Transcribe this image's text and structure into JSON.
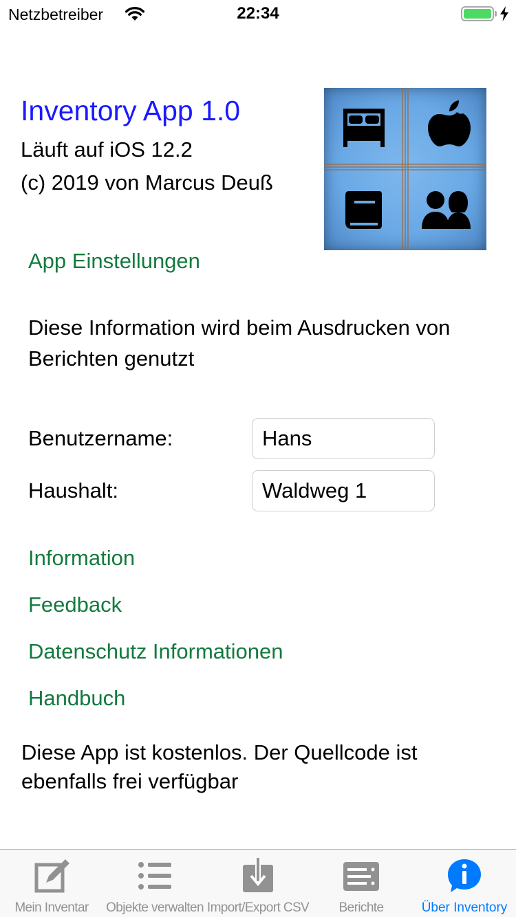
{
  "status_bar": {
    "carrier": "Netzbetreiber",
    "time": "22:34",
    "battery_level": 1.0
  },
  "header": {
    "title": "Inventory App 1.0",
    "ios_version": "Läuft auf iOS 12.2",
    "copyright": "(c) 2019 von Marcus Deuß",
    "logo_icons": [
      "bed-icon",
      "apple-icon",
      "book-icon",
      "people-icon"
    ]
  },
  "settings": {
    "app_settings_link": "App Einstellungen",
    "info_text": "Diese Information wird beim Ausdrucken von Berichten genutzt",
    "username_label": "Benutzername:",
    "username_value": "Hans",
    "household_label": "Haushalt:",
    "household_value": "Waldweg 1"
  },
  "links": {
    "information": "Information",
    "feedback": "Feedback",
    "privacy": "Datenschutz Informationen",
    "manual": "Handbuch"
  },
  "footer_text": "Diese App ist kostenlos. Der Quellcode ist ebenfalls frei verfügbar",
  "tab_bar": {
    "tabs": [
      {
        "label": "Mein Inventar",
        "icon": "edit-icon",
        "active": false
      },
      {
        "label": "Objekte verwalten",
        "icon": "list-icon",
        "active": false
      },
      {
        "label": "Import/Export CSV",
        "icon": "download-icon",
        "active": false
      },
      {
        "label": "Berichte",
        "icon": "report-icon",
        "active": false
      },
      {
        "label": "Über Inventory",
        "icon": "info-icon",
        "active": true
      }
    ]
  },
  "colors": {
    "title": "#1a1aff",
    "link": "#137a3e",
    "tab_active": "#007aff",
    "tab_inactive": "#929292",
    "battery": "#4cd964"
  }
}
